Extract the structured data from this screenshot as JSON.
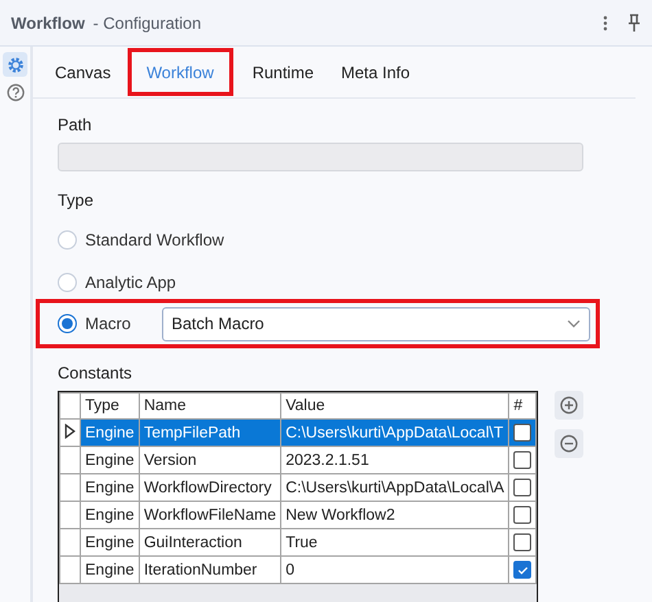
{
  "header": {
    "title": "Workflow",
    "subtitle": "- Configuration"
  },
  "tabs": [
    {
      "label": "Canvas",
      "selected": false,
      "highlighted": false
    },
    {
      "label": "Workflow",
      "selected": true,
      "highlighted": true
    },
    {
      "label": "Runtime",
      "selected": false,
      "highlighted": false
    },
    {
      "label": "Meta Info",
      "selected": false,
      "highlighted": false
    }
  ],
  "path": {
    "label": "Path"
  },
  "type": {
    "label": "Type",
    "options": [
      {
        "label": "Standard Workflow",
        "selected": false,
        "highlighted": false
      },
      {
        "label": "Analytic App",
        "selected": false,
        "highlighted": false
      },
      {
        "label": "Macro",
        "selected": true,
        "highlighted": true,
        "dropdown": "Batch Macro"
      }
    ]
  },
  "constants": {
    "label": "Constants",
    "columns": [
      "Type",
      "Name",
      "Value",
      "#"
    ],
    "rows": [
      {
        "type": "Engine",
        "name": "TempFilePath",
        "value": "C:\\Users\\kurti\\AppData\\Local\\T",
        "checked": false,
        "selected": true
      },
      {
        "type": "Engine",
        "name": "Version",
        "value": "2023.2.1.51",
        "checked": false,
        "selected": false
      },
      {
        "type": "Engine",
        "name": "WorkflowDirectory",
        "value": "C:\\Users\\kurti\\AppData\\Local\\A",
        "checked": false,
        "selected": false
      },
      {
        "type": "Engine",
        "name": "WorkflowFileName",
        "value": "New Workflow2",
        "checked": false,
        "selected": false
      },
      {
        "type": "Engine",
        "name": "GuiInteraction",
        "value": "True",
        "checked": false,
        "selected": false
      },
      {
        "type": "Engine",
        "name": "IterationNumber",
        "value": "0",
        "checked": true,
        "selected": false
      }
    ]
  }
}
